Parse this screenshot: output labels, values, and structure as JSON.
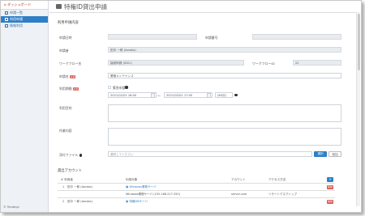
{
  "sidebar": {
    "header": "ダッシュボード",
    "items": [
      {
        "label": "申請一覧",
        "active": false
      },
      {
        "label": "利用申請",
        "active": true
      },
      {
        "label": "情報利用",
        "active": false
      }
    ],
    "footer": "© Tendaya"
  },
  "page": {
    "title": "特権ID貸出申請"
  },
  "section1": {
    "title": "利用申請内容",
    "fields": {
      "date_label": "申請日時",
      "date_value": "",
      "number_label": "申請番号",
      "number_value": "",
      "applicant_label": "申請者",
      "applicant_value": "田中 一郎 (tanaka)",
      "workflow_label": "ワークフロー名",
      "workflow_value": "接続申請 (ID01)",
      "workflow_id_label": "ワークフローID",
      "workflow_id_value": "22",
      "name_label": "申請名",
      "name_value": "業務メンテナンス",
      "period_label": "利用期間",
      "urgent_label": "緊急申請",
      "start": "2021/02/01 16:00",
      "end": "2021/02/01 17:00",
      "tilde": "～",
      "duration": "(60分)",
      "purpose_label": "利用目的",
      "work_label": "作業内容",
      "attach_label": "添付ファイル",
      "attach_placeholder": "選択してください",
      "select_btn": "選択",
      "add_btn": "追加",
      "required": "必須"
    }
  },
  "section2": {
    "title": "貸出アカウント",
    "columns": [
      "# 利用者",
      "利用対象",
      "アカウント",
      "アクセス方法"
    ],
    "rows": [
      {
        "num": "1",
        "user": "田中 一郎 (tanaka)",
        "target": "Windows業務サーバ",
        "account": "",
        "method": "",
        "btn": "削除"
      },
      {
        "num": "",
        "user": "",
        "target": "Windows業務サーバ (192.168.217.250)",
        "account": "server-user",
        "method": "リモートデスクトップ",
        "btn": ""
      },
      {
        "num": "2",
        "user": "田中 一郎 (tanaka)",
        "target": "特権DBサーバ",
        "account": "",
        "method": "",
        "btn": "削除"
      }
    ]
  }
}
